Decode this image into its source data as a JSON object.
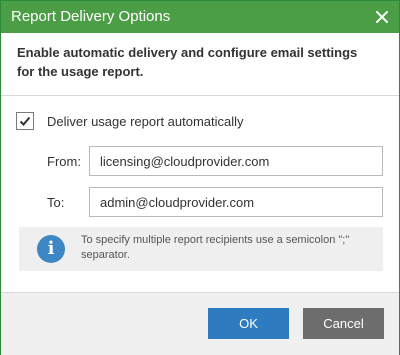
{
  "dialog": {
    "title": "Report Delivery Options",
    "close_icon": "close-icon"
  },
  "header": {
    "text": "Enable automatic delivery and configure email settings for the usage report."
  },
  "options": {
    "auto_delivery_checked": true,
    "auto_delivery_label": "Deliver usage report automatically",
    "from_label": "From:",
    "from_value": "licensing@cloudprovider.com",
    "to_label": "To:",
    "to_value": "admin@cloudprovider.com"
  },
  "info": {
    "icon": "info-icon",
    "text": "To specify multiple report recipients use a semicolon \";\" separator."
  },
  "footer": {
    "ok_label": "OK",
    "cancel_label": "Cancel"
  },
  "colors": {
    "titlebar": "#4c9e46",
    "ok_button": "#2f7bbf",
    "cancel_button": "#6d6d6d",
    "info_icon": "#3d87c4"
  }
}
